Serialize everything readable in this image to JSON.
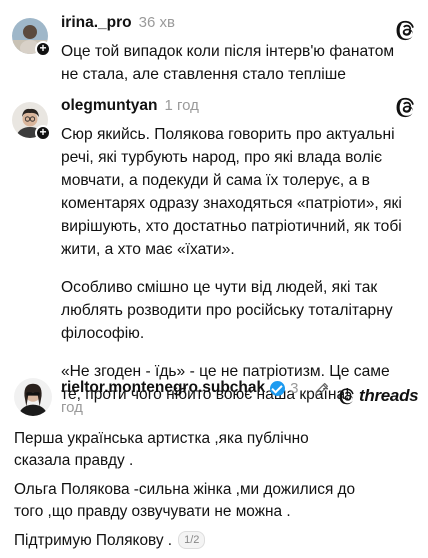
{
  "posts": [
    {
      "username": "irina._pro",
      "time": "36 хв",
      "icon": "threads-icon",
      "paragraphs": [
        "Оце той випадок коли після інтерв'ю фанатом не стала, але ставлення стало тепліше"
      ]
    },
    {
      "username": "olegmuntyan",
      "time": "1 год",
      "icon": "threads-icon",
      "paragraphs": [
        "Сюр якийсь. Полякова говорить про актуальні речі, які турбують народ, про які влада воліє мовчати, а подекуди й сама їх толерує, а в коментарях одразу знаходяться «патріоти», які вирішують, хто достатньо патріотичний, як тобі жити, а хто має «їхати».",
        "Особливо смішно це чути від людей, які так люблять розводити про російську тоталітарну філософію.",
        "«Не згоден - їдь» - це не патріотизм. Це саме те, проти чого нібито воює наша країна!"
      ]
    }
  ],
  "post3": {
    "username": "rieltor.montenegro.subchak",
    "time_num": "3",
    "time_unit": "год",
    "brand": "threads",
    "verified": true,
    "paragraphs": [
      "Перша українська артистка ,яка публічно сказала правду .",
      "Ольга Полякова -сильна жінка ,ми дожилися до того ,що правду озвучувати не можна .",
      "Підтримую Полякову ."
    ],
    "page_indicator": "1/2"
  },
  "colors": {
    "text": "#111111",
    "muted": "#9a9a9a",
    "verified": "#1d9bf0"
  }
}
